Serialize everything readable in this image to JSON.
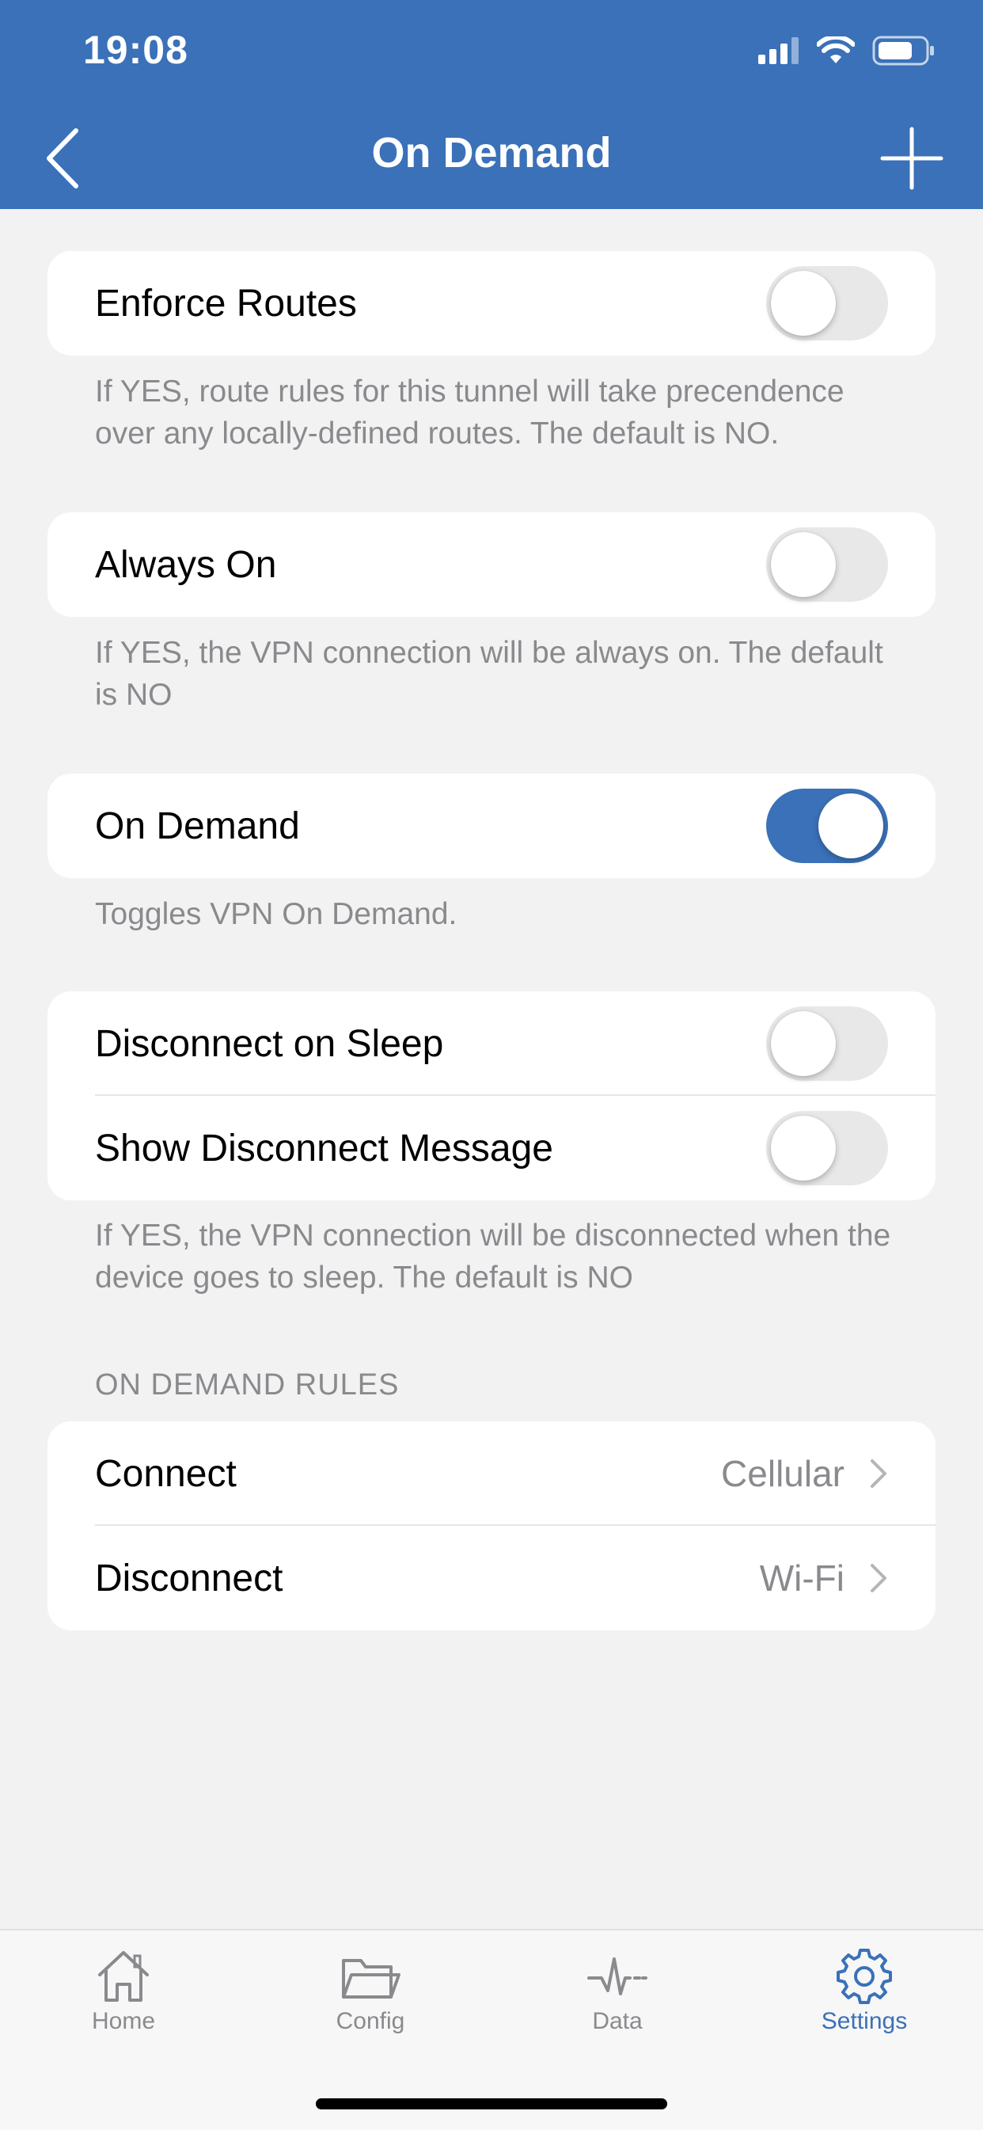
{
  "status_bar": {
    "time": "19:08"
  },
  "nav": {
    "title": "On Demand"
  },
  "settings": {
    "enforce_routes": {
      "label": "Enforce Routes",
      "enabled": false,
      "footnote": "If YES, route rules for this tunnel will take precendence over any locally-defined routes. The default is NO."
    },
    "always_on": {
      "label": "Always On",
      "enabled": false,
      "footnote": "If YES, the VPN connection will be always on. The default is NO"
    },
    "on_demand": {
      "label": "On Demand",
      "enabled": true,
      "footnote": "Toggles VPN On Demand."
    },
    "disconnect_on_sleep": {
      "label": "Disconnect on Sleep",
      "enabled": false
    },
    "show_disconnect_message": {
      "label": "Show Disconnect Message",
      "enabled": false
    },
    "sleep_footnote": "If YES, the VPN connection will be disconnected when the device goes to sleep. The default is NO"
  },
  "rules": {
    "header": "ON DEMAND RULES",
    "items": [
      {
        "label": "Connect",
        "value": "Cellular"
      },
      {
        "label": "Disconnect",
        "value": "Wi-Fi"
      }
    ]
  },
  "tabbar": {
    "items": [
      {
        "label": "Home",
        "icon": "house-icon",
        "active": false
      },
      {
        "label": "Config",
        "icon": "folder-icon",
        "active": false
      },
      {
        "label": "Data",
        "icon": "pulse-icon",
        "active": false
      },
      {
        "label": "Settings",
        "icon": "gear-icon",
        "active": true
      }
    ]
  },
  "colors": {
    "accent": "#3a71b8",
    "background": "#f2f2f2",
    "secondary_text": "#8a8a8e"
  }
}
